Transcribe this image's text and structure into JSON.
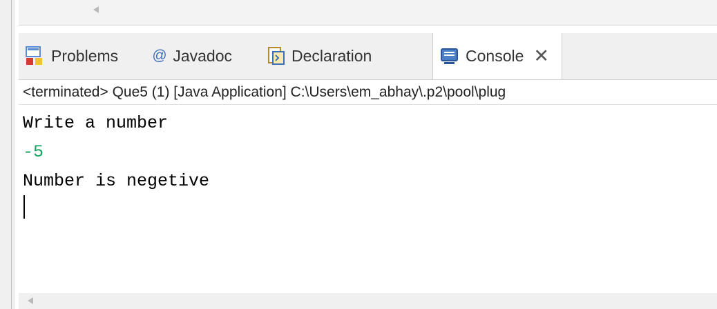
{
  "tabs": [
    {
      "label": "Problems",
      "icon": "problems-icon"
    },
    {
      "label": "Javadoc",
      "icon": "javadoc-at-icon",
      "glyph": "@"
    },
    {
      "label": "Declaration",
      "icon": "declaration-icon"
    },
    {
      "label": "Console",
      "icon": "console-icon",
      "active": true,
      "close": "✕"
    }
  ],
  "status": "<terminated> Que5 (1) [Java Application] C:\\Users\\em_abhay\\.p2\\pool\\plug",
  "console": {
    "lines": [
      {
        "text": "Write a number",
        "color": "#000000"
      },
      {
        "text": "-5",
        "color": "#17a362"
      },
      {
        "text": "Number is negetive",
        "color": "#000000"
      }
    ]
  },
  "colors": {
    "input_text": "#17a362",
    "tab_bar_bg": "#f0f0f0",
    "console_bg": "#ffffff"
  }
}
